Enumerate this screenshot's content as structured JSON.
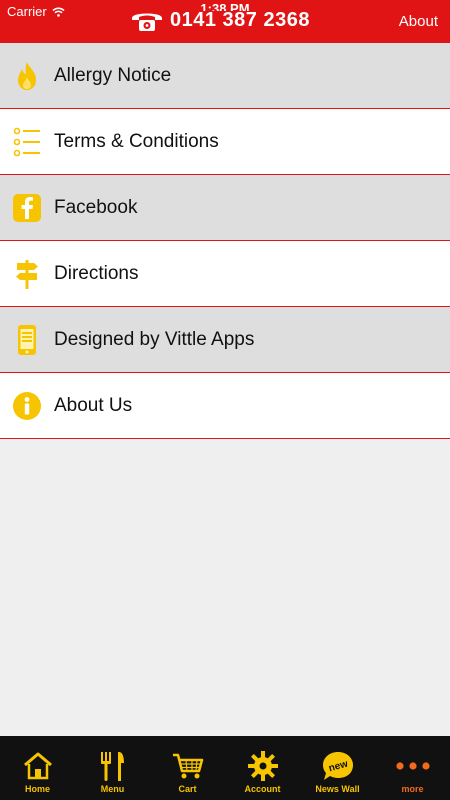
{
  "status": {
    "carrier": "Carrier",
    "time": "1:38 PM"
  },
  "header": {
    "phone": "0141 387 2368",
    "about": "About"
  },
  "menu": [
    {
      "label": "Allergy Notice",
      "icon": "fire-icon"
    },
    {
      "label": "Terms & Conditions",
      "icon": "list-icon"
    },
    {
      "label": "Facebook",
      "icon": "facebook-icon"
    },
    {
      "label": "Directions",
      "icon": "signpost-icon"
    },
    {
      "label": "Designed by Vittle Apps",
      "icon": "phone-device-icon"
    },
    {
      "label": "About Us",
      "icon": "info-icon"
    }
  ],
  "tabs": [
    {
      "label": "Home",
      "icon": "home-icon"
    },
    {
      "label": "Menu",
      "icon": "cutlery-icon"
    },
    {
      "label": "Cart",
      "icon": "cart-icon"
    },
    {
      "label": "Account",
      "icon": "gear-icon"
    },
    {
      "label": "News Wall",
      "icon": "new-badge-icon",
      "badge": "new"
    },
    {
      "label": "more",
      "icon": "more-dots-icon",
      "active": true
    }
  ],
  "colors": {
    "brand_red": "#e01414",
    "icon_yellow": "#f6c400",
    "active_orange": "#f26a1b"
  }
}
